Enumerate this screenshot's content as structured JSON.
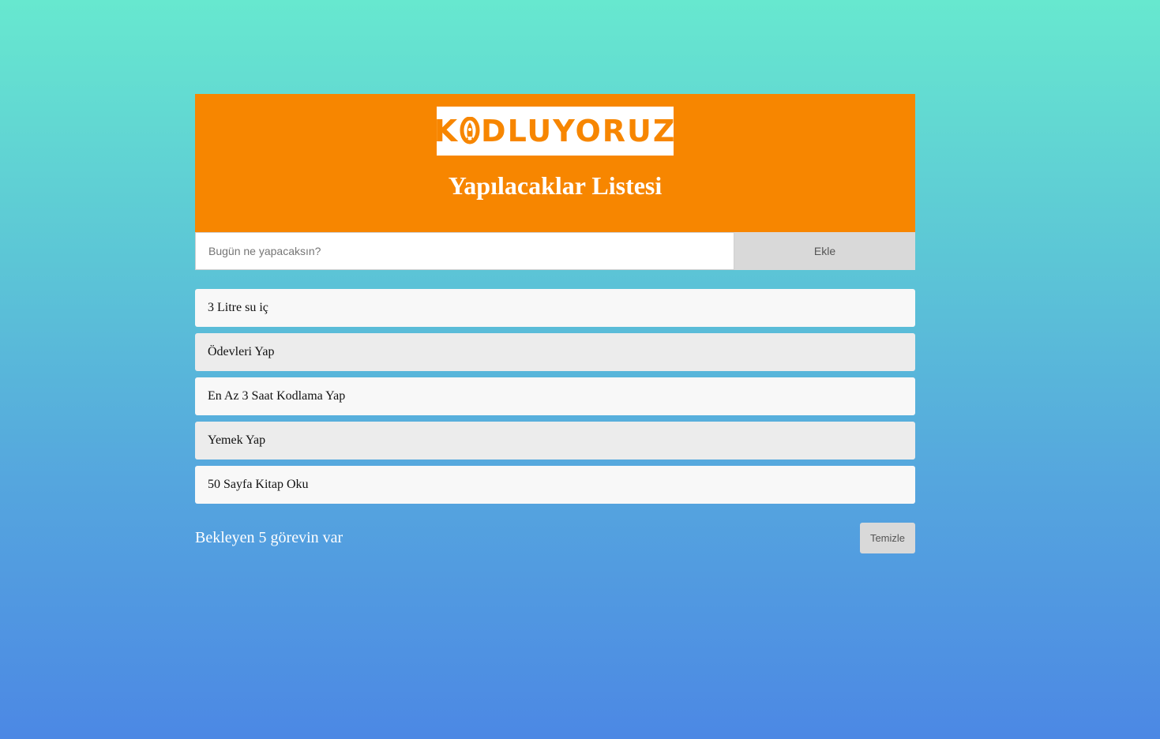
{
  "header": {
    "logo_before": "K",
    "logo_after": "DLUYORUZ",
    "logo_full": "KODLUYORUZ",
    "title": "Yapılacaklar Listesi",
    "brand_color": "#f78600"
  },
  "form": {
    "input_placeholder": "Bugün ne yapacaksın?",
    "input_value": "",
    "add_label": "Ekle"
  },
  "tasks": [
    "3 Litre su iç",
    "Ödevleri Yap",
    "En Az 3 Saat Kodlama Yap",
    "Yemek Yap",
    "50 Sayfa Kitap Oku"
  ],
  "footer": {
    "pending_text": "Bekleyen 5 görevin var",
    "clear_label": "Temizle"
  }
}
